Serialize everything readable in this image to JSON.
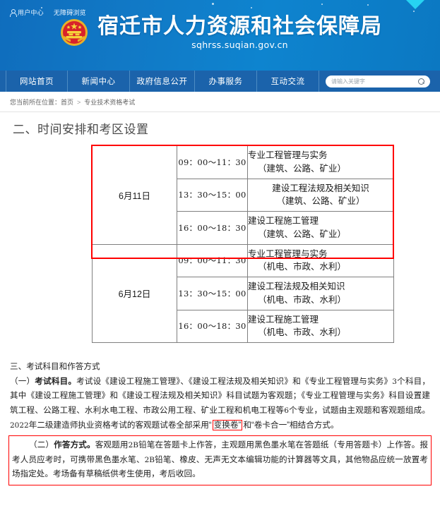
{
  "banner": {
    "top_links": [
      {
        "icon": "user-icon",
        "label": "用户中心"
      },
      {
        "label": "无障碍浏览"
      }
    ],
    "emblem_name": "national-emblem",
    "title": "宿迁市人力资源和社会保障局",
    "url": "sqhrss.suqian.gov.cn",
    "accent_blue": "#0e7ac6",
    "accent_cyan": "#27d3f2"
  },
  "nav": {
    "items": [
      {
        "label": "网站首页"
      },
      {
        "label": "新闻中心"
      },
      {
        "label": "政府信息公开"
      },
      {
        "label": "办事服务"
      },
      {
        "label": "互动交流"
      }
    ],
    "bar_color": "#1b63ab",
    "search": {
      "placeholder": "请输入关键字",
      "value": "",
      "icon": "search-icon"
    }
  },
  "breadcrumb": {
    "prefix": "您当前所在位置：",
    "items": [
      "首页",
      "专业技术资格考试"
    ],
    "separator": ">"
  },
  "section": {
    "title": "二、时间安排和考区设置"
  },
  "schedule": {
    "highlight_color": "#ff0000",
    "days": [
      {
        "date": "6月11日",
        "highlighted": true,
        "rows": [
          {
            "time": "09：00～11：30",
            "subject": "专业工程管理与实务",
            "scope": "（建筑、公路、矿业）",
            "align": "left"
          },
          {
            "time": "13：30～15：00",
            "subject": "建设工程法规及相关知识",
            "scope": "（建筑、公路、矿业）",
            "align": "center"
          },
          {
            "time": "16：00～18：30",
            "subject": "建设工程施工管理",
            "scope": "（建筑、公路、矿业）",
            "align": "left"
          }
        ]
      },
      {
        "date": "6月12日",
        "highlighted": false,
        "rows": [
          {
            "time": "09：00～11：30",
            "subject": "专业工程管理与实务",
            "scope": "（机电、市政、水利）",
            "align": "left"
          },
          {
            "time": "13：30～15：00",
            "subject": "建设工程法规及相关知识",
            "scope": "（机电、市政、水利）",
            "align": "left"
          },
          {
            "time": "16：00～18：30",
            "subject": "建设工程施工管理",
            "scope": "（机电、市政、水利）",
            "align": "left"
          }
        ]
      }
    ]
  },
  "article": {
    "heading3": "三、考试科目和作答方式",
    "para1_label": "（一）",
    "para1_bold": "考试科目。",
    "para1_a": "考试设《建设工程施工管理》、《建设工程法规及相关知识》和《专业工程管理与实务》",
    "para1_num1": "3",
    "para1_b": "个科目，其中《建设工程施工管理》和《建设工程法规及相关知识》科目试题为客观题；《专业工程管理与实务》科目设置建筑工程、公路工程、水利水电工程、市政公用工程、矿业工程和机电工程等",
    "para1_num2": "6",
    "para1_c": "个专业，试题由主观题和客观题组成。",
    "para1_num3": "2022",
    "para1_d": "年二级建造师执业资格考试的客观题试卷全部采用“",
    "para1_marked": "变换卷”",
    "para1_e": "和“卷卡合一”相结合方式。",
    "para2_label": "（二）",
    "para2_bold": "作答方式。",
    "para2_a": "客观题用",
    "para2_num1": "2B",
    "para2_b": "铅笔在答题卡上作答，主观题用黑色墨水笔在答题纸（专用答题卡）上作答。报考人员应考时，可携带黑色墨水笔、",
    "para2_num2": "2B",
    "para2_c": "铅笔、橡皮、无声无文本编辑功能的计算器等文具，其他物品应统一放置考场指定处。考场备有草稿纸供考生使用，考后收回。"
  }
}
